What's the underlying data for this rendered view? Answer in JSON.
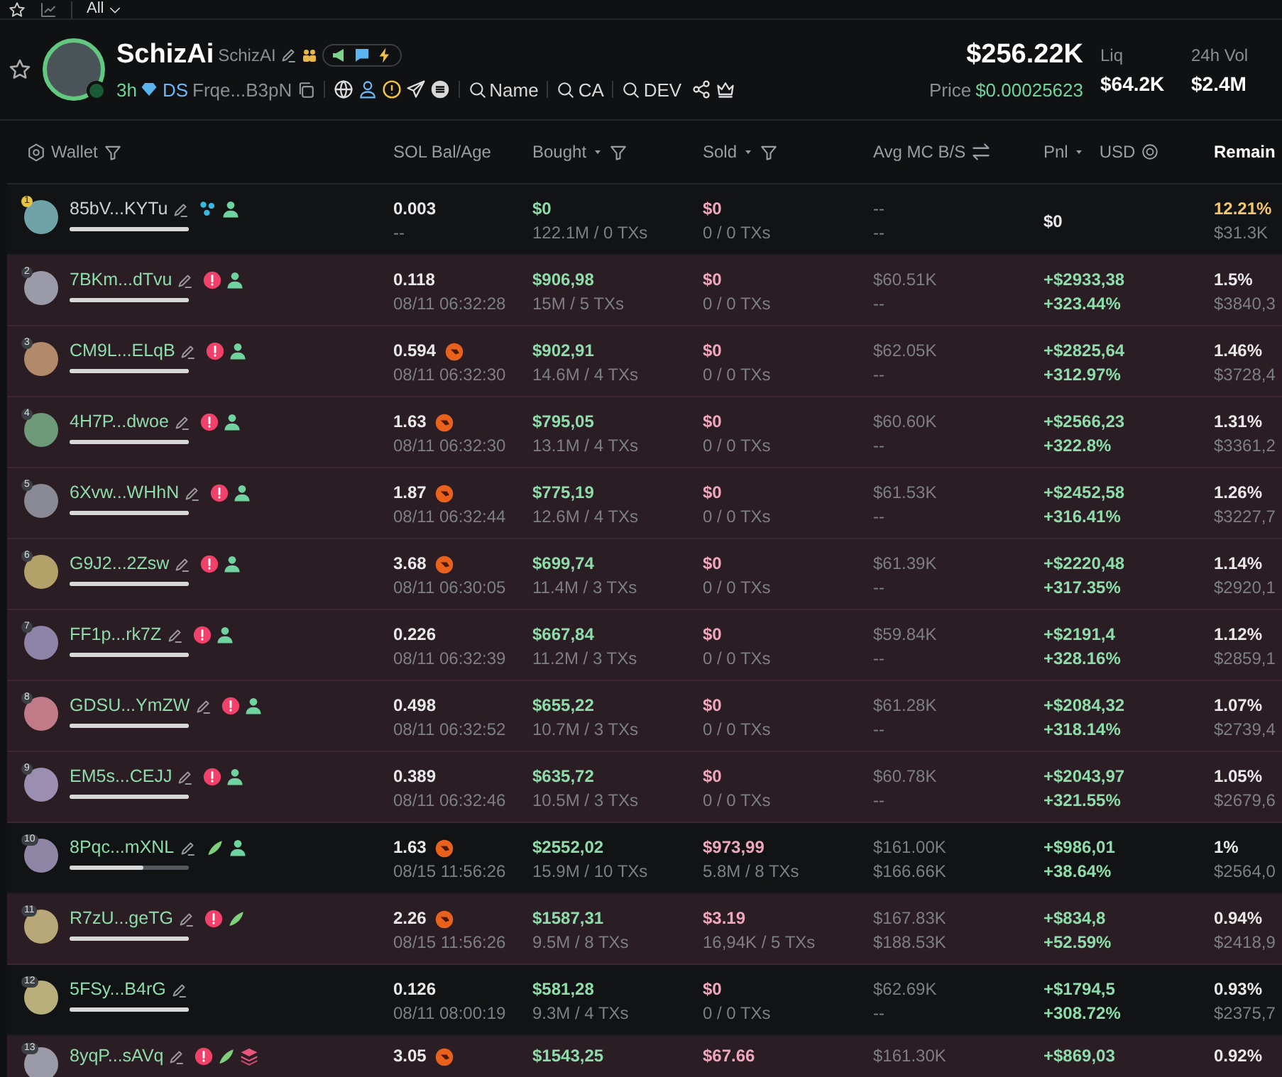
{
  "top_bar": {
    "filter": "All"
  },
  "token": {
    "name": "SchizAi",
    "ticker": "SchizAI",
    "age": "3h",
    "dex": "DS",
    "address": "Frqe...B3pN",
    "search_links": [
      "Name",
      "CA",
      "DEV"
    ],
    "market_cap": "$256.22K",
    "price_label": "Price",
    "price": "$0.00025623",
    "stats": [
      {
        "label": "Liq",
        "value": "$64.2K"
      },
      {
        "label": "24h Vol",
        "value": "$2.4M"
      }
    ]
  },
  "columns": [
    {
      "label": "Wallet",
      "kind": "wallet"
    },
    {
      "label": "SOL Bal/Age",
      "kind": "plain"
    },
    {
      "label": "Bought",
      "kind": "sort-filter"
    },
    {
      "label": "Sold",
      "kind": "sort-filter"
    },
    {
      "label": "Avg MC B/S",
      "kind": "swap"
    },
    {
      "label": "Pnl",
      "kind": "pnl",
      "unit": "USD"
    },
    {
      "label": "Remain",
      "kind": "strong"
    }
  ],
  "rows": [
    {
      "rank": "1",
      "color": "#6fa3a8",
      "wallet": "85bV...KYTu",
      "highlighted": false,
      "named": false,
      "level": 1,
      "tags": [
        {
          "kind": "bundle"
        },
        {
          "kind": "user"
        }
      ],
      "sol": "0.003",
      "age": "--",
      "shrimp": false,
      "bought": "$0",
      "bought_detail": "122.1M / 0 TXs",
      "sold": "$0",
      "sold_detail": "0 / 0 TXs",
      "avg_buy": "--",
      "avg_sell": "--",
      "pnl": "$0",
      "positive": false,
      "remain_pct": "12.21%",
      "remain_usd": "$31.3K",
      "warning": true
    },
    {
      "rank": "2",
      "color": "#9a9aa8",
      "wallet": "7BKm...dTvu",
      "highlighted": true,
      "named": true,
      "level": 1,
      "tags": [
        {
          "kind": "alert"
        },
        {
          "kind": "user"
        }
      ],
      "sol": "0.118",
      "age": "08/11 06:32:28",
      "shrimp": false,
      "bought": "$906,98",
      "bought_detail": "15M / 5 TXs",
      "sold": "$0",
      "sold_detail": "0 / 0 TXs",
      "avg_buy": "$60.51K",
      "avg_sell": "--",
      "pnl": "+$2933,38",
      "pnl_pct": "+323.44%",
      "positive": true,
      "remain_pct": "1.5%",
      "remain_usd": "$3840,3",
      "warning": false
    },
    {
      "rank": "3",
      "color": "#b08a6a",
      "wallet": "CM9L...ELqB",
      "highlighted": true,
      "named": true,
      "level": 1,
      "tags": [
        {
          "kind": "alert"
        },
        {
          "kind": "user"
        }
      ],
      "sol": "0.594",
      "age": "08/11 06:32:30",
      "shrimp": true,
      "bought": "$902,91",
      "bought_detail": "14.6M / 4 TXs",
      "sold": "$0",
      "sold_detail": "0 / 0 TXs",
      "avg_buy": "$62.05K",
      "avg_sell": "--",
      "pnl": "+$2825,64",
      "pnl_pct": "+312.97%",
      "positive": true,
      "remain_pct": "1.46%",
      "remain_usd": "$3728,4",
      "warning": false
    },
    {
      "rank": "4",
      "color": "#6f9a7a",
      "wallet": "4H7P...dwoe",
      "highlighted": true,
      "named": true,
      "level": 1,
      "tags": [
        {
          "kind": "alert"
        },
        {
          "kind": "user"
        }
      ],
      "sol": "1.63",
      "age": "08/11 06:32:30",
      "shrimp": true,
      "bought": "$795,05",
      "bought_detail": "13.1M / 4 TXs",
      "sold": "$0",
      "sold_detail": "0 / 0 TXs",
      "avg_buy": "$60.60K",
      "avg_sell": "--",
      "pnl": "+$2566,23",
      "pnl_pct": "+322.8%",
      "positive": true,
      "remain_pct": "1.31%",
      "remain_usd": "$3361,2",
      "warning": false
    },
    {
      "rank": "5",
      "color": "#8a8a96",
      "wallet": "6Xvw...WHhN",
      "highlighted": true,
      "named": true,
      "level": 1,
      "tags": [
        {
          "kind": "alert"
        },
        {
          "kind": "user"
        }
      ],
      "sol": "1.87",
      "age": "08/11 06:32:44",
      "shrimp": true,
      "bought": "$775,19",
      "bought_detail": "12.6M / 4 TXs",
      "sold": "$0",
      "sold_detail": "0 / 0 TXs",
      "avg_buy": "$61.53K",
      "avg_sell": "--",
      "pnl": "+$2452,58",
      "pnl_pct": "+316.41%",
      "positive": true,
      "remain_pct": "1.26%",
      "remain_usd": "$3227,7",
      "warning": false
    },
    {
      "rank": "6",
      "color": "#b3a16a",
      "wallet": "G9J2...2Zsw",
      "highlighted": true,
      "named": true,
      "level": 1,
      "tags": [
        {
          "kind": "alert"
        },
        {
          "kind": "user"
        }
      ],
      "sol": "3.68",
      "age": "08/11 06:30:05",
      "shrimp": true,
      "bought": "$699,74",
      "bought_detail": "11.4M / 3 TXs",
      "sold": "$0",
      "sold_detail": "0 / 0 TXs",
      "avg_buy": "$61.39K",
      "avg_sell": "--",
      "pnl": "+$2220,48",
      "pnl_pct": "+317.35%",
      "positive": true,
      "remain_pct": "1.14%",
      "remain_usd": "$2920,1",
      "warning": false
    },
    {
      "rank": "7",
      "color": "#8e84a8",
      "wallet": "FF1p...rk7Z",
      "highlighted": true,
      "named": true,
      "level": 1,
      "tags": [
        {
          "kind": "alert"
        },
        {
          "kind": "user"
        }
      ],
      "sol": "0.226",
      "age": "08/11 06:32:39",
      "shrimp": false,
      "bought": "$667,84",
      "bought_detail": "11.2M / 3 TXs",
      "sold": "$0",
      "sold_detail": "0 / 0 TXs",
      "avg_buy": "$59.84K",
      "avg_sell": "--",
      "pnl": "+$2191,4",
      "pnl_pct": "+328.16%",
      "positive": true,
      "remain_pct": "1.12%",
      "remain_usd": "$2859,1",
      "warning": false
    },
    {
      "rank": "8",
      "color": "#c07a88",
      "wallet": "GDSU...YmZW",
      "highlighted": true,
      "named": true,
      "level": 1,
      "tags": [
        {
          "kind": "alert"
        },
        {
          "kind": "user"
        }
      ],
      "sol": "0.498",
      "age": "08/11 06:32:52",
      "shrimp": false,
      "bought": "$655,22",
      "bought_detail": "10.7M / 3 TXs",
      "sold": "$0",
      "sold_detail": "0 / 0 TXs",
      "avg_buy": "$61.28K",
      "avg_sell": "--",
      "pnl": "+$2084,32",
      "pnl_pct": "+318.14%",
      "positive": true,
      "remain_pct": "1.07%",
      "remain_usd": "$2739,4",
      "warning": false
    },
    {
      "rank": "9",
      "color": "#9a8fb0",
      "wallet": "EM5s...CEJJ",
      "highlighted": true,
      "named": true,
      "level": 1,
      "tags": [
        {
          "kind": "alert"
        },
        {
          "kind": "user"
        }
      ],
      "sol": "0.389",
      "age": "08/11 06:32:46",
      "shrimp": false,
      "bought": "$635,72",
      "bought_detail": "10.5M / 3 TXs",
      "sold": "$0",
      "sold_detail": "0 / 0 TXs",
      "avg_buy": "$60.78K",
      "avg_sell": "--",
      "pnl": "+$2043,97",
      "pnl_pct": "+321.55%",
      "positive": true,
      "remain_pct": "1.05%",
      "remain_usd": "$2679,6",
      "warning": false
    },
    {
      "rank": "10",
      "color": "#8f86a6",
      "wallet": "8Pqc...mXNL",
      "highlighted": false,
      "named": true,
      "level": 0.62,
      "tags": [
        {
          "kind": "leaf"
        },
        {
          "kind": "user"
        }
      ],
      "sol": "1.63",
      "age": "08/15 11:56:26",
      "shrimp": true,
      "bought": "$2552,02",
      "bought_detail": "15.9M / 10 TXs",
      "sold": "$973,99",
      "sold_detail": "5.8M / 8 TXs",
      "avg_buy": "$161.00K",
      "avg_sell": "$166.66K",
      "pnl": "+$986,01",
      "pnl_pct": "+38.64%",
      "positive": true,
      "remain_pct": "1%",
      "remain_usd": "$2564,0",
      "warning": false
    },
    {
      "rank": "11",
      "color": "#b8a878",
      "wallet": "R7zU...geTG",
      "highlighted": true,
      "named": true,
      "level": 1,
      "tags": [
        {
          "kind": "alert"
        },
        {
          "kind": "leaf"
        }
      ],
      "sol": "2.26",
      "age": "08/15 11:56:26",
      "shrimp": true,
      "bought": "$1587,31",
      "bought_detail": "9.5M / 8 TXs",
      "sold": "$3.19",
      "sold_detail": "16,94K / 5 TXs",
      "avg_buy": "$167.83K",
      "avg_sell": "$188.53K",
      "pnl": "+$834,8",
      "pnl_pct": "+52.59%",
      "positive": true,
      "remain_pct": "0.94%",
      "remain_usd": "$2418,9",
      "warning": false
    },
    {
      "rank": "12",
      "color": "#b7ae7a",
      "wallet": "5FSy...B4rG",
      "highlighted": false,
      "named": true,
      "level": 1,
      "tags": [],
      "sol": "0.126",
      "age": "08/11 08:00:19",
      "shrimp": false,
      "bought": "$581,28",
      "bought_detail": "9.3M / 4 TXs",
      "sold": "$0",
      "sold_detail": "0 / 0 TXs",
      "avg_buy": "$62.69K",
      "avg_sell": "--",
      "pnl": "+$1794,5",
      "pnl_pct": "+308.72%",
      "positive": true,
      "remain_pct": "0.93%",
      "remain_usd": "$2375,7",
      "warning": false
    },
    {
      "rank": "13",
      "color": "#9a9aa8",
      "wallet": "8yqP...sAVq",
      "highlighted": true,
      "named": true,
      "tags": [
        {
          "kind": "alert"
        },
        {
          "kind": "leaf"
        },
        {
          "kind": "layers"
        }
      ],
      "sol": "3.05",
      "shrimp": true,
      "bought": "$1543,25",
      "sold": "$67.66",
      "avg_buy": "$161.30K",
      "pnl": "+$869,03",
      "positive": true,
      "remain_pct": "0.92%",
      "warning": false
    }
  ]
}
